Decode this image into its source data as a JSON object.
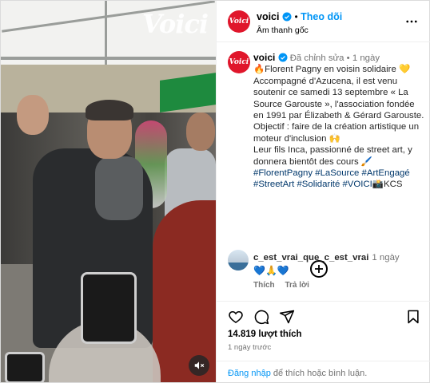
{
  "media": {
    "watermark": "Voici"
  },
  "header": {
    "username": "voici",
    "separator": "•",
    "follow_label": "Theo dõi",
    "audio_label": "Âm thanh gốc",
    "avatar_text": "Voici"
  },
  "caption": {
    "avatar_text": "Voici",
    "username": "voici",
    "edited_label": "Đã chỉnh sửa",
    "time": "1 ngày",
    "line1": "🔥Florent Pagny en voisin solidaire 💛",
    "line2": "Accompagné d'Azucena, il est venu soutenir ce samedi 13 septembre « La Source Garouste », l'association fondée en 1991 par Élizabeth & Gérard Garouste.",
    "line3": "Objectif : faire de la création artistique un moteur d'inclusion 🙌",
    "line4": "Leur fils Inca, passionné de street art, y donnera bientôt des cours 🖌️",
    "hashtags": [
      "#FlorentPagny",
      "#LaSource",
      "#ArtEngagé",
      "#StreetArt",
      "#Solidarité",
      "#VOICI"
    ],
    "credit": "📸KCS"
  },
  "comment": {
    "username": "c_est_vrai_que_c_est_vrai",
    "time": "1 ngày",
    "text": "💙🙏💙",
    "like_label": "Thích",
    "reply_label": "Trả lời"
  },
  "stats": {
    "likes": "14.819 lượt thích",
    "posted": "1 ngày trước"
  },
  "footer": {
    "login_link": "Đăng nhập",
    "login_text": "để thích hoặc bình luận."
  },
  "colors": {
    "brand": "#e0162b",
    "link": "#0095f6",
    "hashtag": "#00376b",
    "muted": "#737373"
  }
}
